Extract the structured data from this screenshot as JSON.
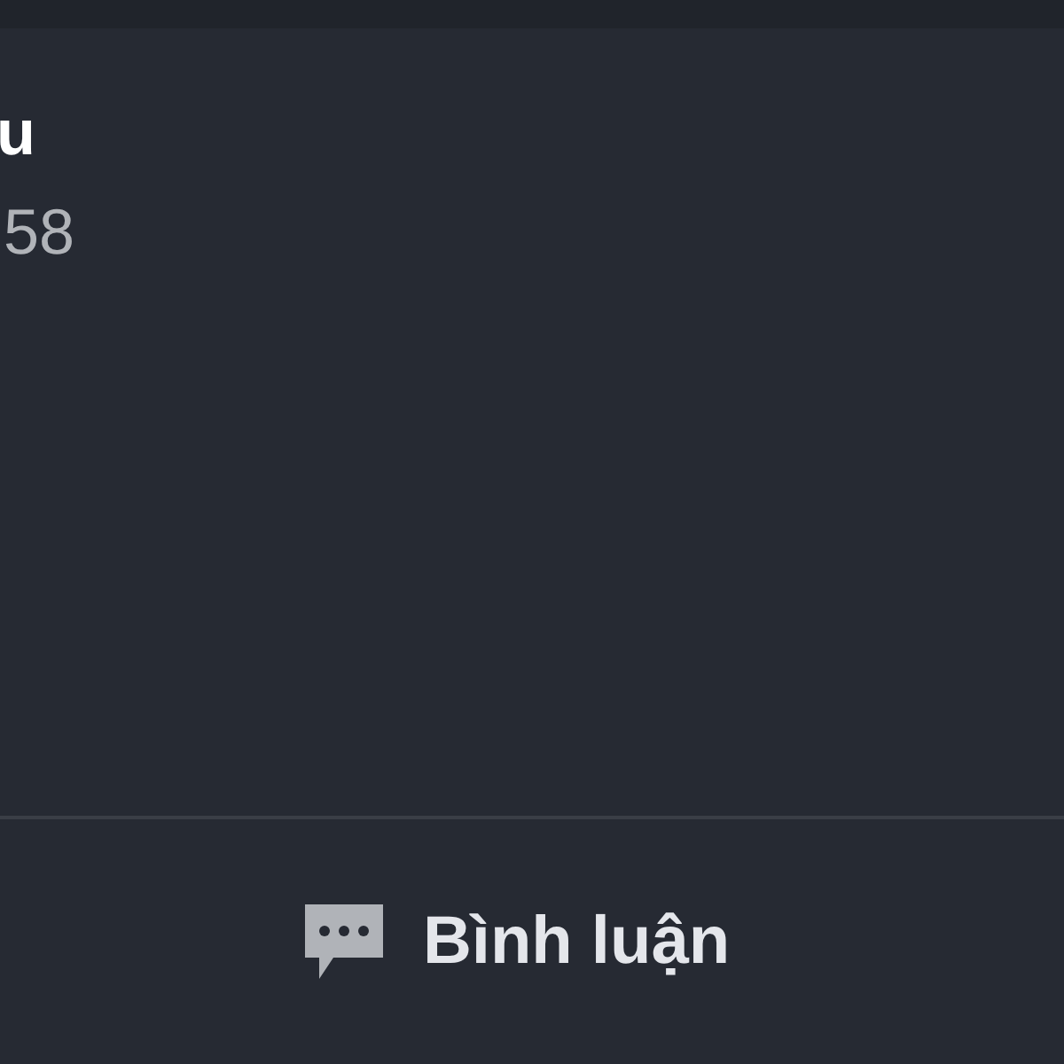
{
  "post": {
    "author": "u",
    "time": "58"
  },
  "actions": [
    {
      "label": "Bình luận",
      "kind": "comment"
    }
  ]
}
